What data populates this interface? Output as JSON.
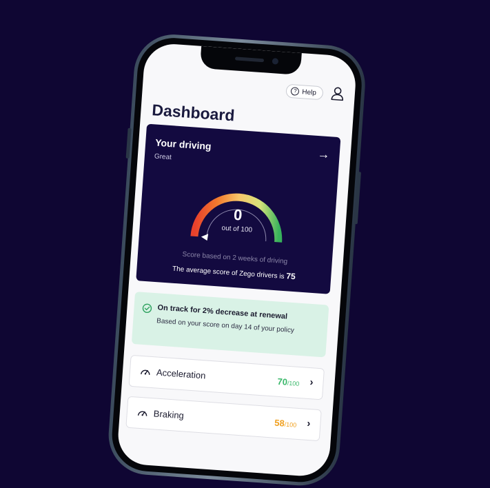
{
  "header": {
    "help_label": "Help",
    "help_glyph": "?"
  },
  "page": {
    "title": "Dashboard"
  },
  "driving_card": {
    "title": "Your driving",
    "rating": "Great",
    "score": "0",
    "score_caption": "out of 100",
    "score_basis": "Score based on 2 weeks of driving",
    "average_text": "The average score of Zego drivers is",
    "average_value": "75",
    "arrow_icon": "arrow-right-icon"
  },
  "track_card": {
    "title": "On track for 2% decrease at renewal",
    "description": "Based on your score on day 14 of your policy",
    "icon": "check-circle-icon"
  },
  "metrics": [
    {
      "label": "Acceleration",
      "score": "70",
      "max": "/100",
      "color": "#3ab86a",
      "icon": "speedometer-icon"
    },
    {
      "label": "Braking",
      "score": "58",
      "max": "/100",
      "color": "#f0a020",
      "icon": "speedometer-icon"
    }
  ],
  "colors": {
    "background": "#0f0633",
    "card_dark": "#130a40",
    "success_bg": "#d9f2e6",
    "success_icon": "#2ea25f"
  }
}
